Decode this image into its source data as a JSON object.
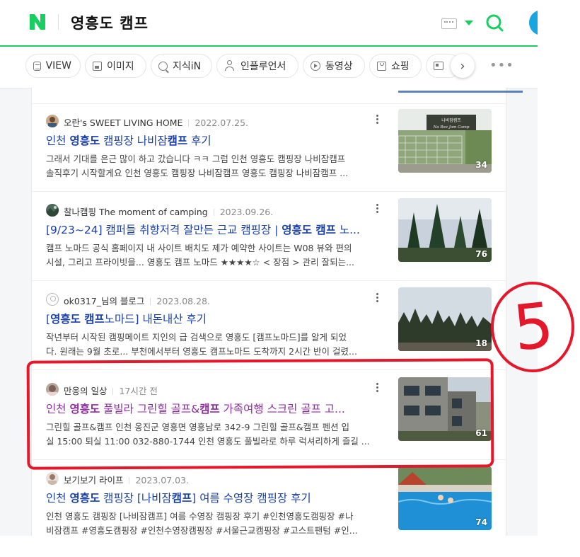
{
  "header": {
    "logo_letter": "N",
    "query": "영흥도 캠프",
    "brand_color": "#19ce60"
  },
  "tabs": [
    {
      "label": "VIEW",
      "icon": "document-icon"
    },
    {
      "label": "이미지",
      "icon": "image-icon"
    },
    {
      "label": "지식iN",
      "icon": "question-icon"
    },
    {
      "label": "인플루언서",
      "icon": "person-icon"
    },
    {
      "label": "동영상",
      "icon": "play-icon"
    },
    {
      "label": "쇼핑",
      "icon": "shopping-bag-icon"
    },
    {
      "label": "",
      "icon": "card-icon"
    }
  ],
  "more_label": "•••",
  "results": [
    {
      "author": "오란's SWEET LIVING HOME",
      "date": "2022.07.25.",
      "title_parts": [
        "인천 ",
        "영흥도",
        " 캠핑장 나비잠",
        "캠프",
        " 후기"
      ],
      "snippet_line1": "그래서 기대를 은근 많이 하고 갔습니다 ㅋㅋ 그럼 인천 영흥도 캠핑장 나비잠캠프",
      "snippet_line2": "솔직후기 시작할게요 인천 영흥도 캠핑장 나비잠캠프 영흥도 캠핑장 나비잠캠프 ...",
      "thumb_sign": "나비잠캠프 Na Bee Jam Camp",
      "image_count": "34"
    },
    {
      "author": "찰나캠핑 The moment of camping",
      "date": "2023.09.26.",
      "title_parts": [
        "[9/23~24] 캠퍼들 취향저격 잘만든 근교 캠핑장 | ",
        "영흥도 캠프",
        " 노..."
      ],
      "snippet_line1": "캠프 노마드 공식 홈페이지 내 사이트 배치도 제가 예약한 사이트는 W08 뷰와 편의",
      "snippet_line2": "시설, 그리고 프라이빗을... 영흥도 캠프 노마드 ★★★★☆ < 장점 > 관리 잘되는...",
      "image_count": "76"
    },
    {
      "author": "ok0317_님의 블로그",
      "date": "2023.08.28.",
      "title_parts": [
        "[",
        "영흥도 캠프",
        "노마드] 내돈내산 후기"
      ],
      "snippet_line1": "작년부터 시작된 캠핑메이트 지인의 급 검색으로 영흥도 [캠프노마드]를 알게 되었",
      "snippet_line2": "다. 원래는 9월 초로... 부천에서부터 영흥도 캠프노마드 도착까지 2시간 반이 걸렸...",
      "image_count": "18"
    },
    {
      "author": "만옹의 일상",
      "date": "17시간 전",
      "title_parts": [
        "인천 ",
        "영흥도",
        " 풀빌라 그린힐 골프&",
        "캠프",
        " 가족여행 스크린 골프 고..."
      ],
      "snippet_line1": "그린힐 골프&캠프 인천 옹진군 영흥면 영흥남로 342-9 그린힐 골프&캠프 펜션 입",
      "snippet_line2": "실 15:00 퇴실 11:00 032-880-1744 인천 영흥도 풀빌라로 하루 럭셔리하게 즐길 ...",
      "image_count": "61"
    },
    {
      "author": "보기보기 라이프",
      "date": "2023.07.03.",
      "title_parts": [
        "인천 ",
        "영흥도",
        " 캠핑장 [나비잠",
        "캠프",
        "] 여름 수영장 캠핑장 후기"
      ],
      "snippet_line1": "인천 영흥도 캠핑장 [나비잠캠프] 여름 수영장 캠핑장 후기 #인천영흥도캠핑장 #나",
      "snippet_line2": "비잠캠프 #영흥도캠핑장 #인천수영장캠핑장 #서울근교캠핑장 #고스트팬텀 #인...",
      "image_count": "74"
    }
  ],
  "annotation": {
    "number": "5",
    "color": "#e5172a"
  }
}
